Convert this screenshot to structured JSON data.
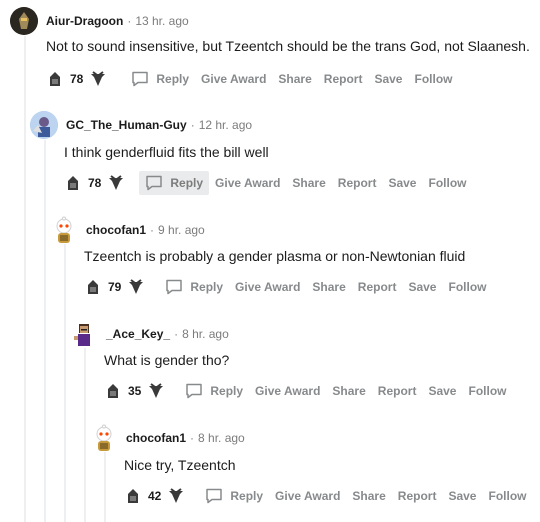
{
  "actions": {
    "reply": "Reply",
    "give_award": "Give Award",
    "share": "Share",
    "report": "Report",
    "save": "Save",
    "follow": "Follow"
  },
  "comments": [
    {
      "author": "Aiur-Dragoon",
      "time": "13 hr. ago",
      "text": "Not to sound insensitive, but Tzeentch should be the trans God, not Slaanesh.",
      "score": "78"
    },
    {
      "author": "GC_The_Human-Guy",
      "time": "12 hr. ago",
      "text": "I think genderfluid fits the bill well",
      "score": "78"
    },
    {
      "author": "chocofan1",
      "time": "9 hr. ago",
      "text": "Tzeentch is probably a gender plasma or non-Newtonian fluid",
      "score": "79"
    },
    {
      "author": "_Ace_Key_",
      "time": "8 hr. ago",
      "text": "What is gender tho?",
      "score": "35"
    },
    {
      "author": "chocofan1",
      "time": "8 hr. ago",
      "text": "Nice try, Tzeentch",
      "score": "42"
    }
  ],
  "separator": "·",
  "colors": {
    "action_gray": "#878a8c",
    "thread_line": "#edeff1",
    "hover_bg": "#e9ebed"
  }
}
